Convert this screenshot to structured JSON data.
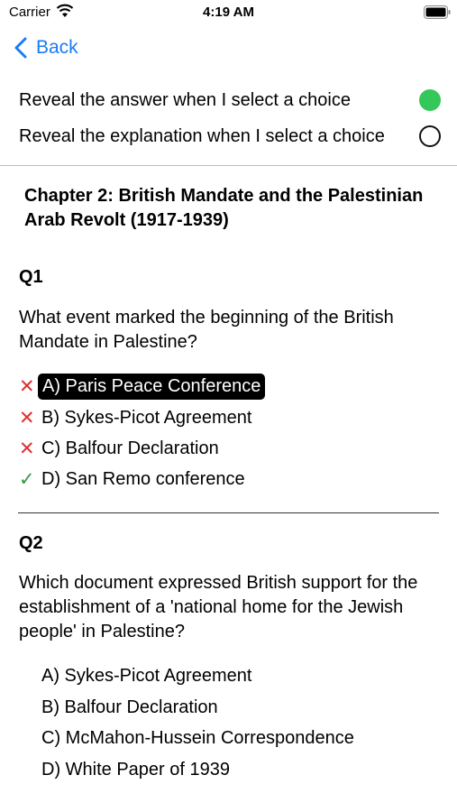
{
  "status_bar": {
    "carrier": "Carrier",
    "time": "4:19 AM"
  },
  "nav": {
    "back_label": "Back"
  },
  "settings": {
    "reveal_answer": {
      "label": "Reveal the answer when I select a choice",
      "on": true
    },
    "reveal_explanation": {
      "label": "Reveal the explanation when I select a choice",
      "on": false
    }
  },
  "chapter_title": "Chapter 2: British Mandate and the Palestinian Arab Revolt (1917-1939)",
  "questions": [
    {
      "label": "Q1",
      "text": "What event marked the beginning of the British Mandate in Palestine?",
      "choices": [
        {
          "text": "A) Paris Peace Conference",
          "mark": "✕",
          "selected": true
        },
        {
          "text": "B) Sykes-Picot Agreement",
          "mark": "✕"
        },
        {
          "text": "C) Balfour Declaration",
          "mark": "✕"
        },
        {
          "text": "D) San Remo conference",
          "mark": "✓"
        }
      ]
    },
    {
      "label": "Q2",
      "text": "Which document expressed British support for the establishment of a 'national home for the Jewish people' in Palestine?",
      "choices": [
        {
          "text": "A) Sykes-Picot Agreement"
        },
        {
          "text": "B) Balfour Declaration"
        },
        {
          "text": "C) McMahon-Hussein Correspondence"
        },
        {
          "text": "D) White Paper of 1939"
        }
      ]
    }
  ],
  "colors": {
    "accent": "#1a7cf5",
    "toggle_on": "#34c759",
    "wrong": "#e0302f",
    "right": "#2e9b3e"
  }
}
